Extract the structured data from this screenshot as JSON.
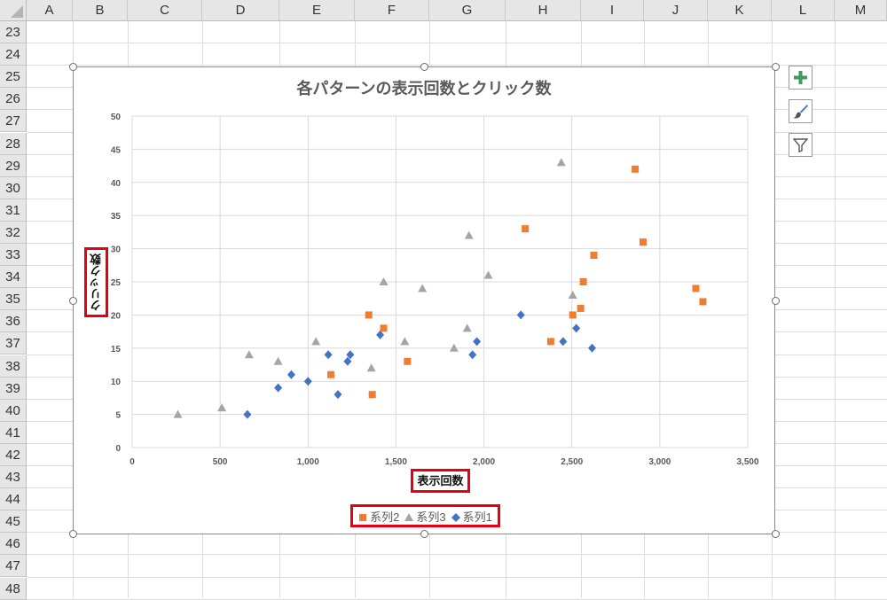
{
  "sheet": {
    "columns": [
      "A",
      "B",
      "C",
      "D",
      "E",
      "F",
      "G",
      "H",
      "I",
      "J",
      "K",
      "L",
      "M"
    ],
    "rows": [
      "23",
      "24",
      "25",
      "26",
      "27",
      "28",
      "29",
      "30",
      "31",
      "32",
      "33",
      "34",
      "35",
      "36",
      "37",
      "38",
      "39",
      "40",
      "41",
      "42",
      "43",
      "44",
      "45",
      "46",
      "47",
      "48"
    ]
  },
  "side_buttons": [
    {
      "icon": "plus-icon"
    },
    {
      "icon": "paintbrush-icon"
    },
    {
      "icon": "filter-icon"
    }
  ],
  "colors": {
    "series1": "#4472C4",
    "series2": "#ED7D31",
    "series3": "#A5A5A5",
    "highlight": "#E60012"
  },
  "chart_data": {
    "type": "scatter",
    "title": "各パターンの表示回数とクリック数",
    "xlabel": "表示回数",
    "ylabel": "クリック数",
    "xlim": [
      0,
      3500
    ],
    "ylim": [
      0,
      50
    ],
    "xticks": [
      "0",
      "500",
      "1,000",
      "1,500",
      "2,000",
      "2,500",
      "3,000",
      "3,500"
    ],
    "yticks": [
      "0",
      "5",
      "10",
      "15",
      "20",
      "25",
      "30",
      "35",
      "40",
      "45",
      "50"
    ],
    "grid": true,
    "legend_position": "bottom",
    "series": [
      {
        "name": "系列2",
        "marker": "square",
        "color": "#ED7D31",
        "points": [
          [
            1130,
            11
          ],
          [
            1345,
            20
          ],
          [
            1365,
            8
          ],
          [
            1430,
            18
          ],
          [
            1565,
            13
          ],
          [
            2235,
            33
          ],
          [
            2380,
            16
          ],
          [
            2505,
            20
          ],
          [
            2550,
            21
          ],
          [
            2565,
            25
          ],
          [
            2625,
            29
          ],
          [
            2860,
            42
          ],
          [
            2905,
            31
          ],
          [
            3205,
            24
          ],
          [
            3245,
            22
          ]
        ]
      },
      {
        "name": "系列3",
        "marker": "triangle",
        "color": "#A5A5A5",
        "points": [
          [
            260,
            5
          ],
          [
            510,
            6
          ],
          [
            665,
            14
          ],
          [
            830,
            13
          ],
          [
            1045,
            16
          ],
          [
            1360,
            12
          ],
          [
            1430,
            25
          ],
          [
            1550,
            16
          ],
          [
            1650,
            24
          ],
          [
            1830,
            15
          ],
          [
            1905,
            18
          ],
          [
            1915,
            32
          ],
          [
            2025,
            26
          ],
          [
            2440,
            43
          ],
          [
            2505,
            23
          ]
        ]
      },
      {
        "name": "系列1",
        "marker": "diamond",
        "color": "#4472C4",
        "points": [
          [
            655,
            5
          ],
          [
            830,
            9
          ],
          [
            905,
            11
          ],
          [
            1000,
            10
          ],
          [
            1115,
            14
          ],
          [
            1170,
            8
          ],
          [
            1225,
            13
          ],
          [
            1240,
            14
          ],
          [
            1410,
            17
          ],
          [
            1935,
            14
          ],
          [
            1960,
            16
          ],
          [
            2210,
            20
          ],
          [
            2450,
            16
          ],
          [
            2525,
            18
          ],
          [
            2615,
            15
          ]
        ]
      }
    ]
  }
}
